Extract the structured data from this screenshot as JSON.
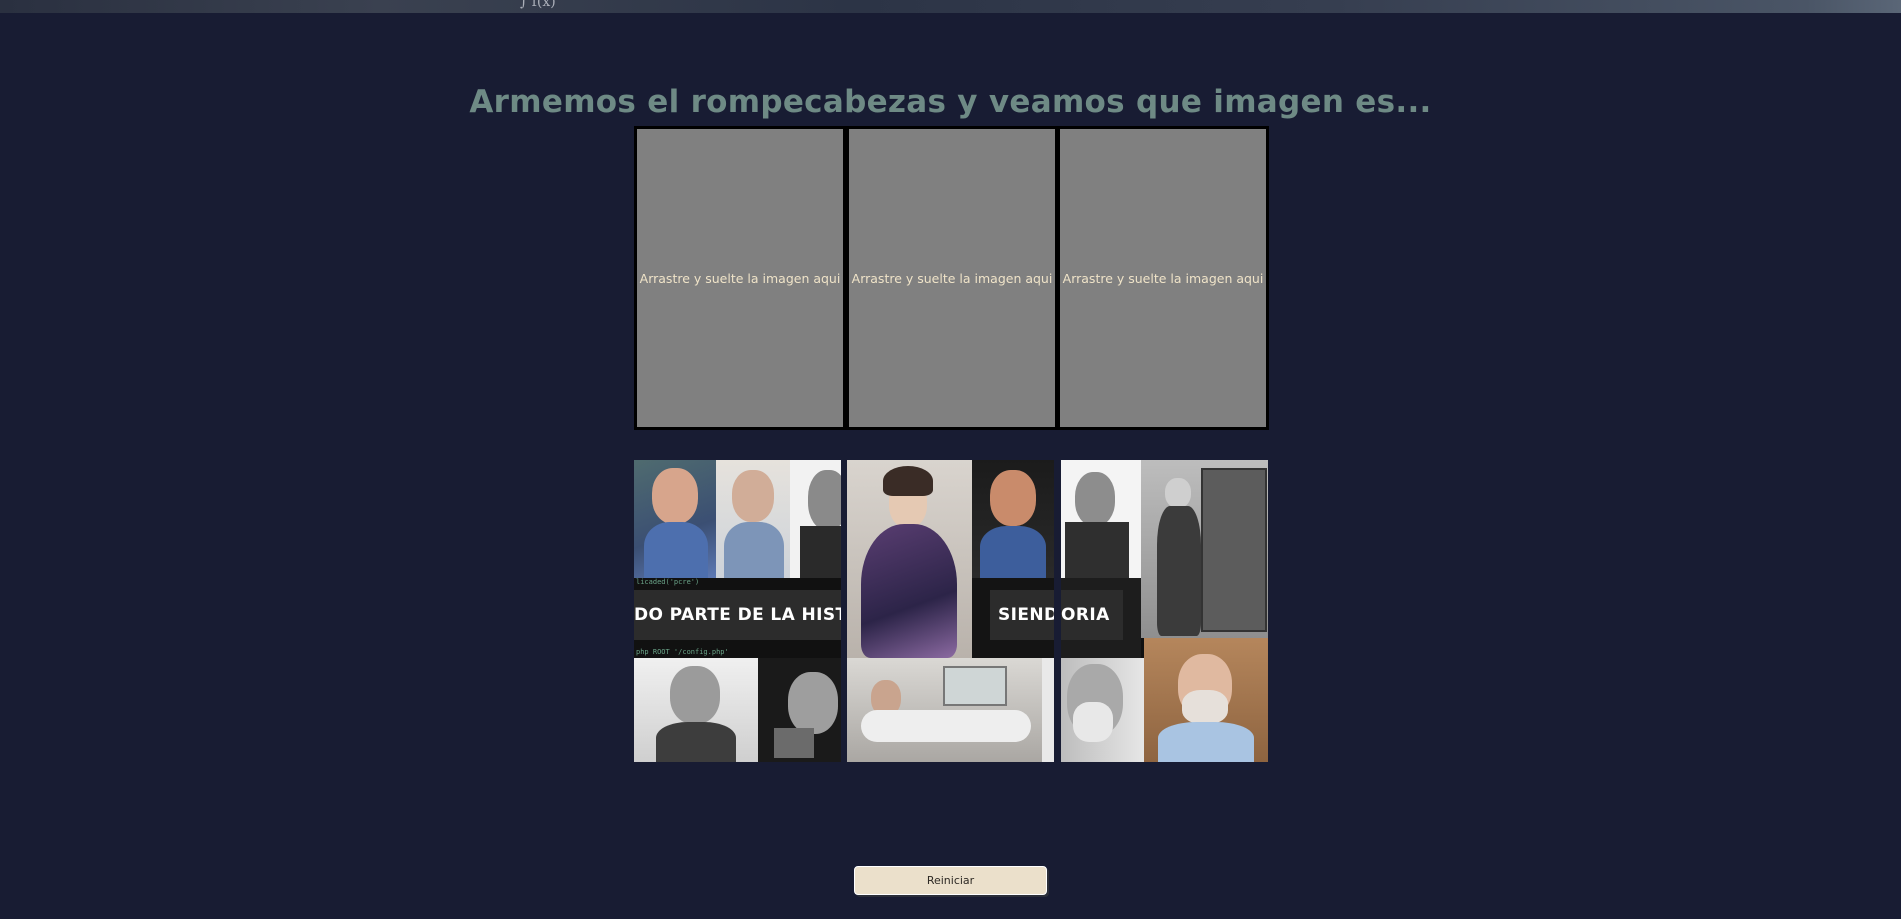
{
  "header_strip": {
    "text": "∫ f(x)"
  },
  "page": {
    "title": "Armemos el rompecabezas y veamos que imagen es..."
  },
  "drop_zones": [
    {
      "label": "Arrastre y suelte la imagen aqui"
    },
    {
      "label": "Arrastre y suelte la imagen aqui"
    },
    {
      "label": "Arrastre y suelte la imagen aqui"
    }
  ],
  "pieces": [
    {
      "banner": "DO PARTE DE LA HISTO"
    },
    {
      "banner": "SIEND"
    },
    {
      "banner": "ORIA"
    }
  ],
  "reset_button": {
    "label": "Reiniciar"
  },
  "colors": {
    "background": "#181c33",
    "title": "#6e8a85",
    "drop_zone": "#808080",
    "drop_text": "#efe3c8",
    "button": "#ebe0cb"
  }
}
